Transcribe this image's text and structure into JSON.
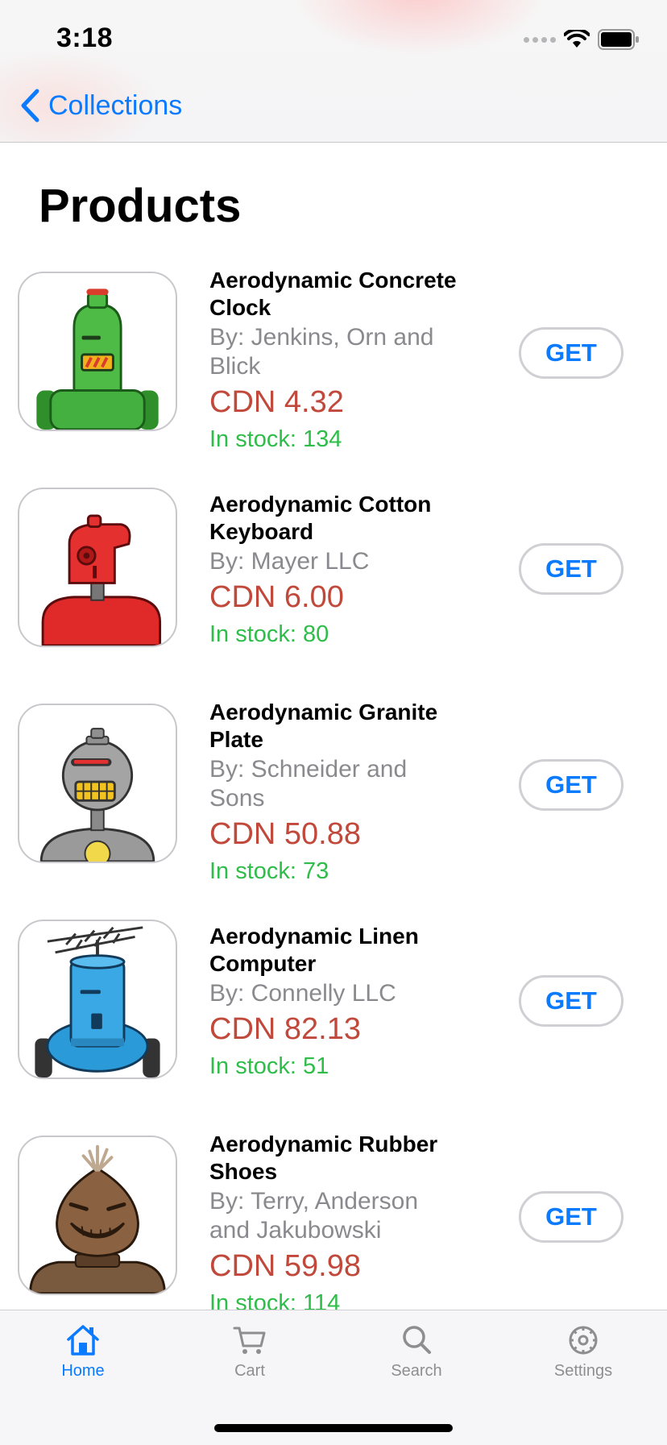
{
  "status_bar": {
    "time": "3:18"
  },
  "nav": {
    "back_label": "Collections"
  },
  "page": {
    "title": "Products"
  },
  "get_label": "GET",
  "products": [
    {
      "name": "Aerodynamic Concrete Clock",
      "vendor": "By: Jenkins, Orn and Blick",
      "price": "CDN 4.32",
      "stock": "In stock: 134",
      "robot": "green"
    },
    {
      "name": "Aerodynamic Cotton Keyboard",
      "vendor": "By: Mayer LLC",
      "price": "CDN 6.00",
      "stock": "In stock: 80",
      "robot": "red"
    },
    {
      "name": "Aerodynamic Granite Plate",
      "vendor": "By: Schneider and Sons",
      "price": "CDN 50.88",
      "stock": "In stock: 73",
      "robot": "gray"
    },
    {
      "name": "Aerodynamic Linen Computer",
      "vendor": "By: Connelly LLC",
      "price": "CDN 82.13",
      "stock": "In stock: 51",
      "robot": "blue"
    },
    {
      "name": "Aerodynamic Rubber Shoes",
      "vendor": "By: Terry, Anderson and Jakubowski",
      "price": "CDN 59.98",
      "stock": "In stock: 114",
      "robot": "brown"
    }
  ],
  "tabs": [
    {
      "label": "Home",
      "icon": "home-icon",
      "active": true
    },
    {
      "label": "Cart",
      "icon": "cart-icon",
      "active": false
    },
    {
      "label": "Search",
      "icon": "search-icon",
      "active": false
    },
    {
      "label": "Settings",
      "icon": "gear-icon",
      "active": false
    }
  ],
  "colors": {
    "accent": "#0a7aff",
    "price": "#c1493b",
    "stock": "#2fbd4a",
    "vendor": "#8a8a8e"
  }
}
